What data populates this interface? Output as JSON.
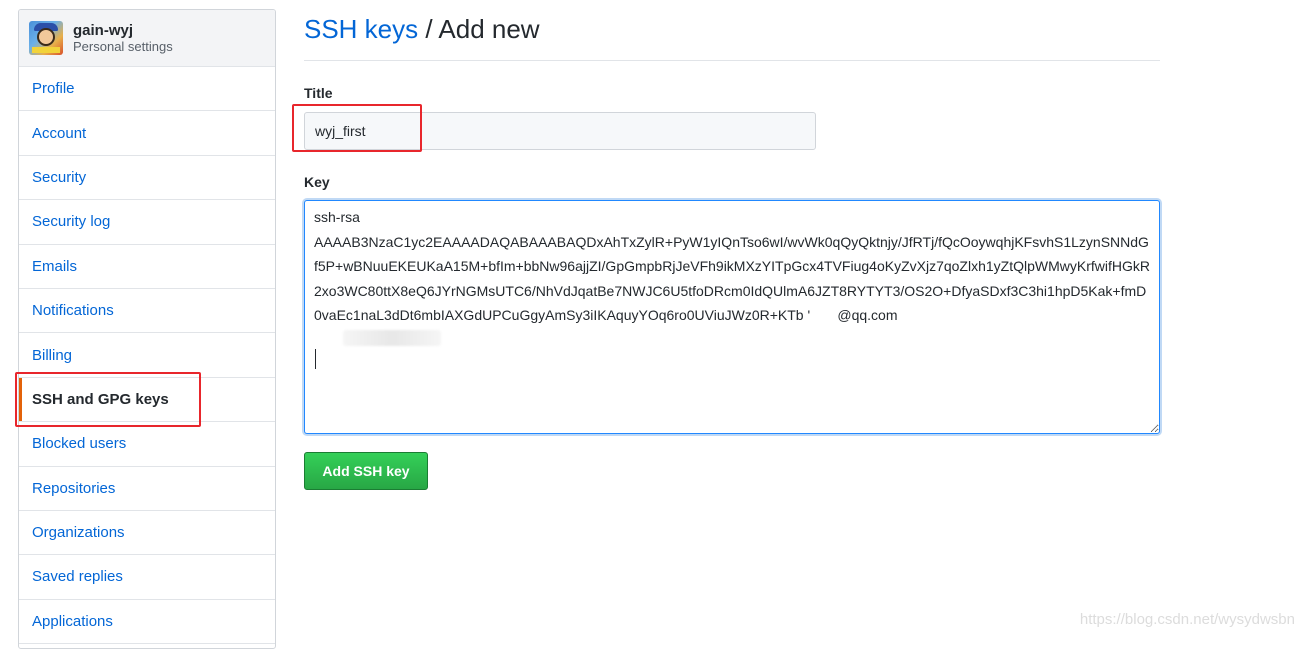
{
  "sidebar": {
    "user_name": "gain-wyj",
    "user_subtitle": "Personal settings",
    "items": [
      {
        "label": "Profile"
      },
      {
        "label": "Account"
      },
      {
        "label": "Security"
      },
      {
        "label": "Security log"
      },
      {
        "label": "Emails"
      },
      {
        "label": "Notifications"
      },
      {
        "label": "Billing"
      },
      {
        "label": "SSH and GPG keys",
        "selected": true
      },
      {
        "label": "Blocked users"
      },
      {
        "label": "Repositories"
      },
      {
        "label": "Organizations"
      },
      {
        "label": "Saved replies"
      },
      {
        "label": "Applications"
      }
    ]
  },
  "main": {
    "breadcrumb_link": "SSH keys",
    "breadcrumb_separator": " / ",
    "breadcrumb_current": "Add new",
    "title_label": "Title",
    "title_value": "wyj_first",
    "key_label": "Key",
    "key_value": "ssh-rsa\nAAAAB3NzaC1yc2EAAAADAQABAAABAQDxAhTxZylR+PyW1yIQnTso6wI/wvWk0qQyQktnjy/JfRTj/fQcOoywqhjKFsvhS1LzynSNNdGf5P+wBNuuEKEUKaA15M+bfIm+bbNw96ajjZI/GpGmpbRjJeVFh9ikMXzYITpGcx4TVFiug4oKyZvXjz7qoZlxh1yZtQlpWMwyKrfwifHGkR2xo3WC80ttX8eQ6JYrNGMsUTC6/NhVdJqatBe7NWJC6U5tfoDRcm0IdQUlmA6JZT8RYTYT3/OS2O+DfyaSDxf3C3hi1hpD5Kak+fmD0vaEc1naL3dDt6mbIAXGdUPCuGgyAmSy3iIKAquyYOq6ro0UViuJWz0R+KTb '       @qq.com",
    "add_button_label": "Add SSH key"
  },
  "colors": {
    "link": "#0366d6",
    "button_green": "#28a745",
    "selected_marker": "#e36209",
    "annotation_red": "#e8262c"
  },
  "watermark": "https://blog.csdn.net/wysydwsbn"
}
